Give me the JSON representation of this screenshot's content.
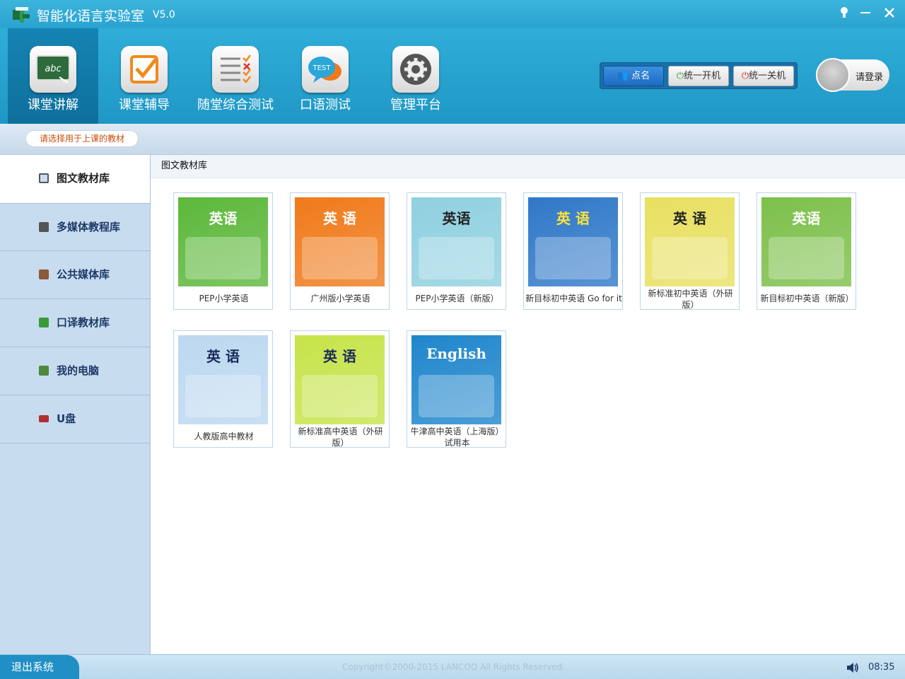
{
  "app": {
    "title": "智能化语言实验室",
    "version": "V5.0"
  },
  "toolbar": {
    "tools": [
      {
        "label": "课堂讲解",
        "icon": "chalkboard-icon"
      },
      {
        "label": "课堂辅导",
        "icon": "checkbox-icon"
      },
      {
        "label": "随堂综合测试",
        "icon": "checklist-icon"
      },
      {
        "label": "口语测试",
        "icon": "speech-test-icon"
      },
      {
        "label": "管理平台",
        "icon": "gear-icon"
      }
    ],
    "test_bubble_text": "TEST",
    "rollcall": "点名",
    "power_on": "统一开机",
    "power_off": "统一关机",
    "login": "请登录"
  },
  "hint": "请选择用于上课的教材",
  "sidebar": {
    "items": [
      {
        "label": "图文教材库",
        "icon": "image-icon",
        "color": "#4a7a4a"
      },
      {
        "label": "多媒体教程库",
        "icon": "film-icon",
        "color": "#555555"
      },
      {
        "label": "公共媒体库",
        "icon": "briefcase-icon",
        "color": "#7a4a2a"
      },
      {
        "label": "口译教材库",
        "icon": "translate-icon",
        "color": "#3a9a3a"
      },
      {
        "label": "我的电脑",
        "icon": "computer-icon",
        "color": "#4a8a3a"
      },
      {
        "label": "U盘",
        "icon": "usb-icon",
        "color": "#b03030"
      }
    ]
  },
  "main": {
    "breadcrumb": "图文教材库",
    "books": [
      {
        "title": "PEP小学英语",
        "cover": "英语",
        "bg": "#5cb83a",
        "fg": "#ffffff"
      },
      {
        "title": "广州版小学英语",
        "cover": "英 语",
        "bg": "#f07a1a",
        "fg": "#ffffff"
      },
      {
        "title": "PEP小学英语（新版）",
        "cover": "英语",
        "bg": "#8fd0e0",
        "fg": "#222222"
      },
      {
        "title": "新目标初中英语 Go for it",
        "cover": "英 语",
        "bg": "#2f78c8",
        "fg": "#ffe23a"
      },
      {
        "title": "新标准初中英语（外研版）",
        "cover": "英 语",
        "bg": "#e8e060",
        "fg": "#222222"
      },
      {
        "title": "新目标初中英语（新版）",
        "cover": "英语",
        "bg": "#7cc04a",
        "fg": "#ffffff"
      },
      {
        "title": "人教版高中教材",
        "cover": "英 语",
        "bg": "#bcd8f0",
        "fg": "#1a2a5a"
      },
      {
        "title": "新标准高中英语（外研版）",
        "cover": "英 语",
        "bg": "#c6e44a",
        "fg": "#1a2a5a"
      },
      {
        "title": "牛津高中英语（上海版）试用本",
        "cover": "English",
        "bg": "#1f86cc",
        "fg": "#ffffff"
      }
    ]
  },
  "status": {
    "exit": "退出系统",
    "copyright": "Copyright©2000-2015 LANCOO All Rights Reserved.",
    "time": "08:35"
  }
}
